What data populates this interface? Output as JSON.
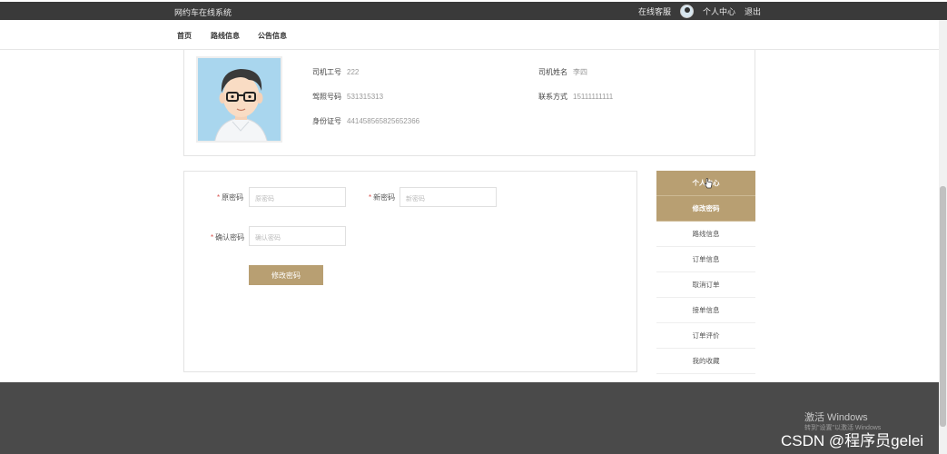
{
  "topbar": {
    "site_title": "网约车在线系统",
    "service": "在线客服",
    "user_center": "个人中心",
    "logout": "退出"
  },
  "nav": [
    "首页",
    "路线信息",
    "公告信息"
  ],
  "profile": {
    "driver_no_label": "司机工号",
    "driver_no": "222",
    "driver_name_label": "司机姓名",
    "driver_name": "李四",
    "license_label": "驾照号码",
    "license": "531315313",
    "contact_label": "联系方式",
    "contact": "15111111111",
    "idcard_label": "身份证号",
    "idcard": "441458565825652366"
  },
  "form": {
    "old_pwd_label": "原密码",
    "old_pwd_placeholder": "原密码",
    "new_pwd_label": "新密码",
    "new_pwd_placeholder": "新密码",
    "confirm_pwd_label": "确认密码",
    "confirm_pwd_placeholder": "确认密码",
    "submit": "修改密码",
    "required_mark": "*"
  },
  "side_menu": [
    "个人中心",
    "修改密码",
    "路线信息",
    "订单信息",
    "取消订单",
    "接单信息",
    "订单评价",
    "我的收藏"
  ],
  "watermark": {
    "activate": "激活 Windows",
    "activate_sub": "转到\"设置\"以激活 Windows",
    "csdn": "CSDN @程序员gelei"
  },
  "colors": {
    "accent": "#b89f72",
    "topbar": "#3a3a3a",
    "footer": "#4a4a4a"
  }
}
